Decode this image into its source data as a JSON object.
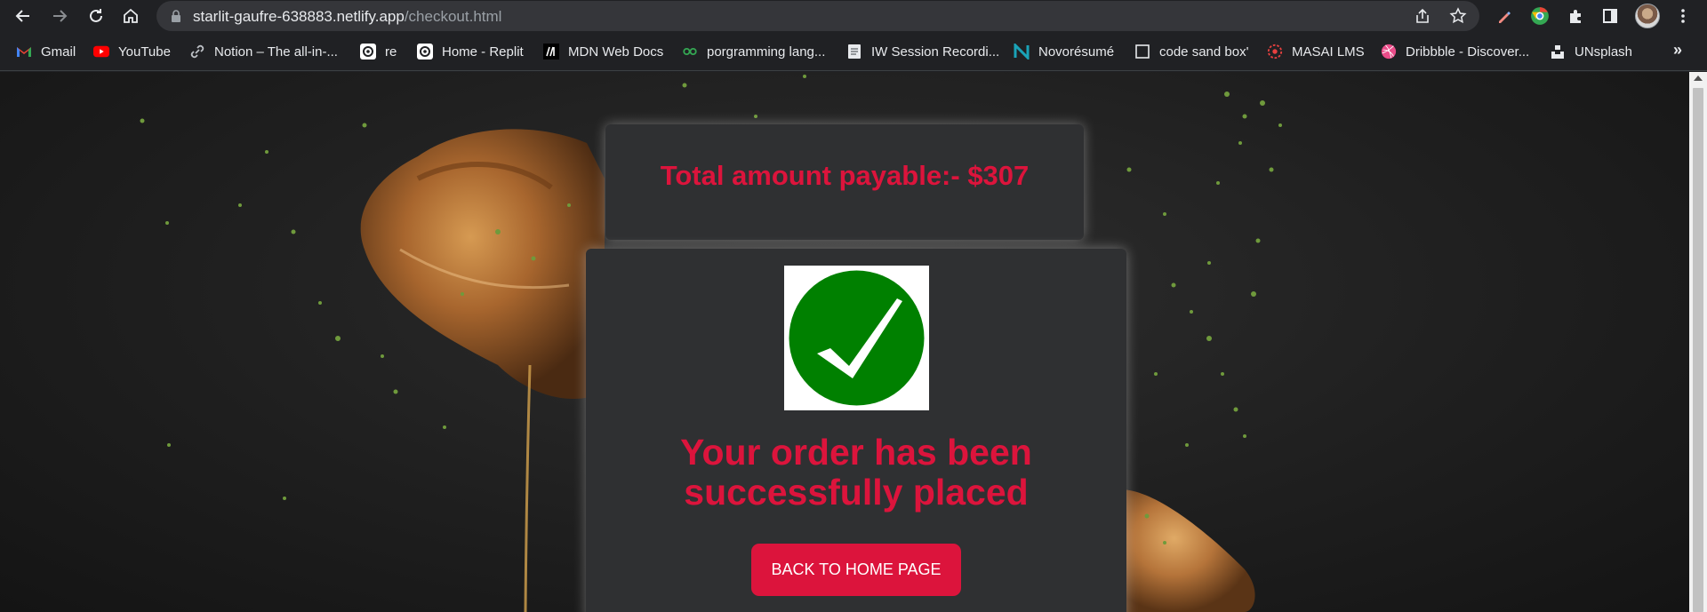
{
  "browser": {
    "url_host": "starlit-gaufre-638883.netlify.app",
    "url_path": "/checkout.html"
  },
  "bookmarks": [
    {
      "label": "Gmail",
      "icon": "gmail-icon"
    },
    {
      "label": "YouTube",
      "icon": "youtube-icon"
    },
    {
      "label": "Notion – The all-in-...",
      "icon": "link-icon"
    },
    {
      "label": "re",
      "icon": "replit-icon"
    },
    {
      "label": "Home - Replit",
      "icon": "replit-icon"
    },
    {
      "label": "MDN Web Docs",
      "icon": "mdn-icon"
    },
    {
      "label": "porgramming lang...",
      "icon": "chain-icon"
    },
    {
      "label": "IW Session Recordi...",
      "icon": "doc-icon"
    },
    {
      "label": "Novorésumé",
      "icon": "novoresume-icon"
    },
    {
      "label": "code sand box'",
      "icon": "codesandbox-icon"
    },
    {
      "label": "MASAI LMS",
      "icon": "masai-icon"
    },
    {
      "label": "Dribbble - Discover...",
      "icon": "dribbble-icon"
    },
    {
      "label": "UNsplash",
      "icon": "unsplash-icon"
    }
  ],
  "bookmarks_overflow": "»",
  "checkout": {
    "total_text": "Total amount payable:- $307",
    "success_text": "Your order has been successfully placed",
    "home_button": "BACK TO HOME PAGE"
  },
  "colors": {
    "accent": "#dc143c",
    "check_green": "#008000",
    "card_bg": "#2f3032"
  }
}
